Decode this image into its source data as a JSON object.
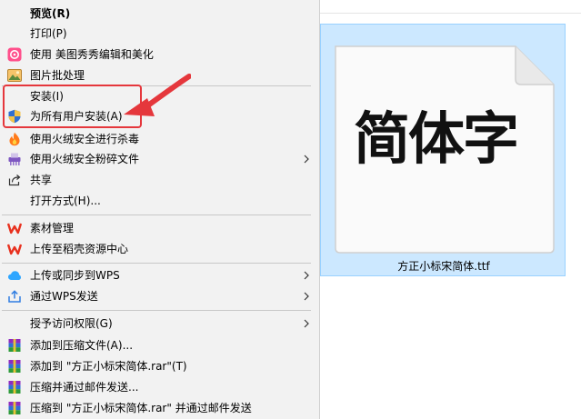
{
  "file": {
    "name": "方正小标宋简体.ttf",
    "preview_text": "简体字"
  },
  "menu": {
    "items": [
      {
        "label": "预览(R)",
        "icon": "none"
      },
      {
        "label": "打印(P)",
        "icon": "none"
      },
      {
        "label": "使用 美图秀秀编辑和美化",
        "icon": "meitu-icon"
      },
      {
        "label": "图片批处理",
        "icon": "image-batch-icon"
      },
      {
        "label": "安装(I)",
        "icon": "none"
      },
      {
        "label": "为所有用户安装(A)",
        "icon": "uac-shield-icon"
      },
      {
        "label": "使用火绒安全进行杀毒",
        "icon": "huorong-flame-icon"
      },
      {
        "label": "使用火绒安全粉碎文件",
        "icon": "shredder-icon"
      },
      {
        "label": "共享",
        "icon": "share-icon"
      },
      {
        "label": "打开方式(H)...",
        "icon": "none"
      },
      {
        "label": "素材管理",
        "icon": "wps-icon"
      },
      {
        "label": "上传至稻壳资源中心",
        "icon": "wps-icon"
      },
      {
        "label": "上传或同步到WPS",
        "icon": "cloud-icon"
      },
      {
        "label": "通过WPS发送",
        "icon": "send-icon"
      },
      {
        "label": "授予访问权限(G)",
        "icon": "none"
      },
      {
        "label": "添加到压缩文件(A)...",
        "icon": "winrar-icon"
      },
      {
        "label": "添加到 \"方正小标宋简体.rar\"(T)",
        "icon": "winrar-icon"
      },
      {
        "label": "压缩并通过邮件发送...",
        "icon": "winrar-icon"
      },
      {
        "label": "压缩到 \"方正小标宋简体.rar\" 并通过邮件发送",
        "icon": "winrar-icon"
      }
    ]
  },
  "colors": {
    "highlight": "#e5373c",
    "selection": "#cce8ff",
    "menu_bg": "#f2f2f2"
  }
}
